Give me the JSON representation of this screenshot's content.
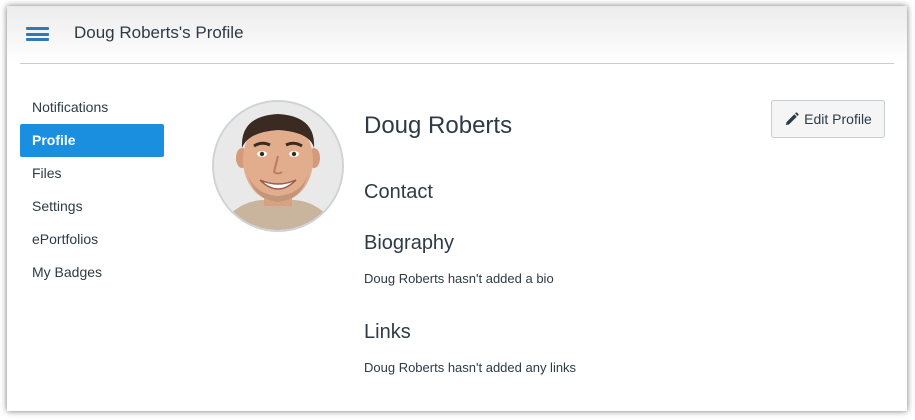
{
  "header": {
    "title": "Doug Roberts's Profile",
    "menu_icon": "hamburger-icon",
    "accent": "#2b7abc"
  },
  "sidebar": {
    "active_color": "#1a8fe0",
    "items": [
      {
        "label": "Notifications",
        "active": false
      },
      {
        "label": "Profile",
        "active": true
      },
      {
        "label": "Files",
        "active": false
      },
      {
        "label": "Settings",
        "active": false
      },
      {
        "label": "ePortfolios",
        "active": false
      },
      {
        "label": "My Badges",
        "active": false
      }
    ]
  },
  "profile": {
    "name": "Doug Roberts",
    "edit_label": "Edit Profile",
    "edit_icon": "pencil-icon",
    "avatar": "avatar-photo"
  },
  "sections": {
    "contact": {
      "title": "Contact"
    },
    "biography": {
      "title": "Biography",
      "text": "Doug Roberts hasn't added a bio"
    },
    "links": {
      "title": "Links",
      "text": "Doug Roberts hasn't added any links"
    }
  }
}
